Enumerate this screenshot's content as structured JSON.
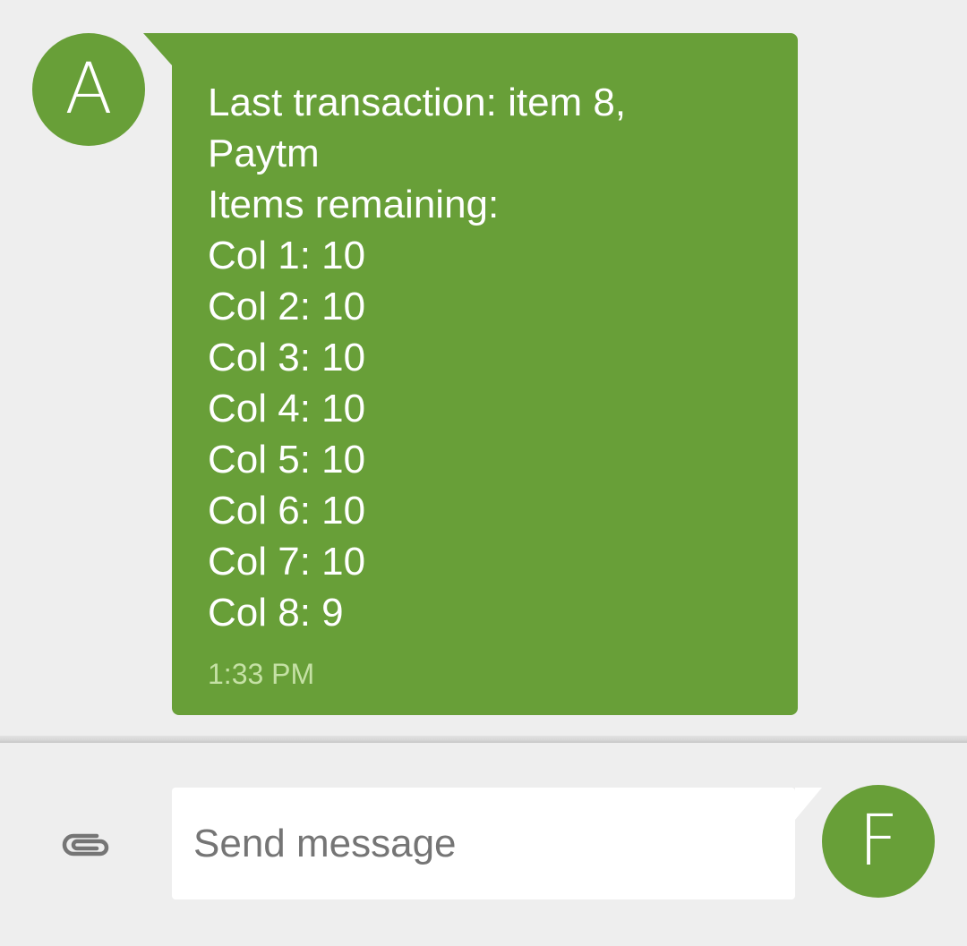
{
  "conversation": {
    "incoming": {
      "avatar_initial": "A",
      "message_lines": [
        "Last transaction: item 8,",
        "Paytm",
        "Items remaining:",
        "Col 1: 10",
        "Col 2: 10",
        "Col 3: 10",
        "Col 4: 10",
        "Col 5: 10",
        "Col 6: 10",
        "Col 7: 10",
        "Col 8: 9"
      ],
      "timestamp": "1:33 PM"
    }
  },
  "compose": {
    "attach_icon": "paperclip-icon",
    "input_value": "",
    "input_placeholder": "Send message",
    "self_avatar_initial": "F"
  },
  "colors": {
    "bubble_green": "#689f38",
    "background": "#eeeeee",
    "timestamp": "#c5e1a5"
  }
}
